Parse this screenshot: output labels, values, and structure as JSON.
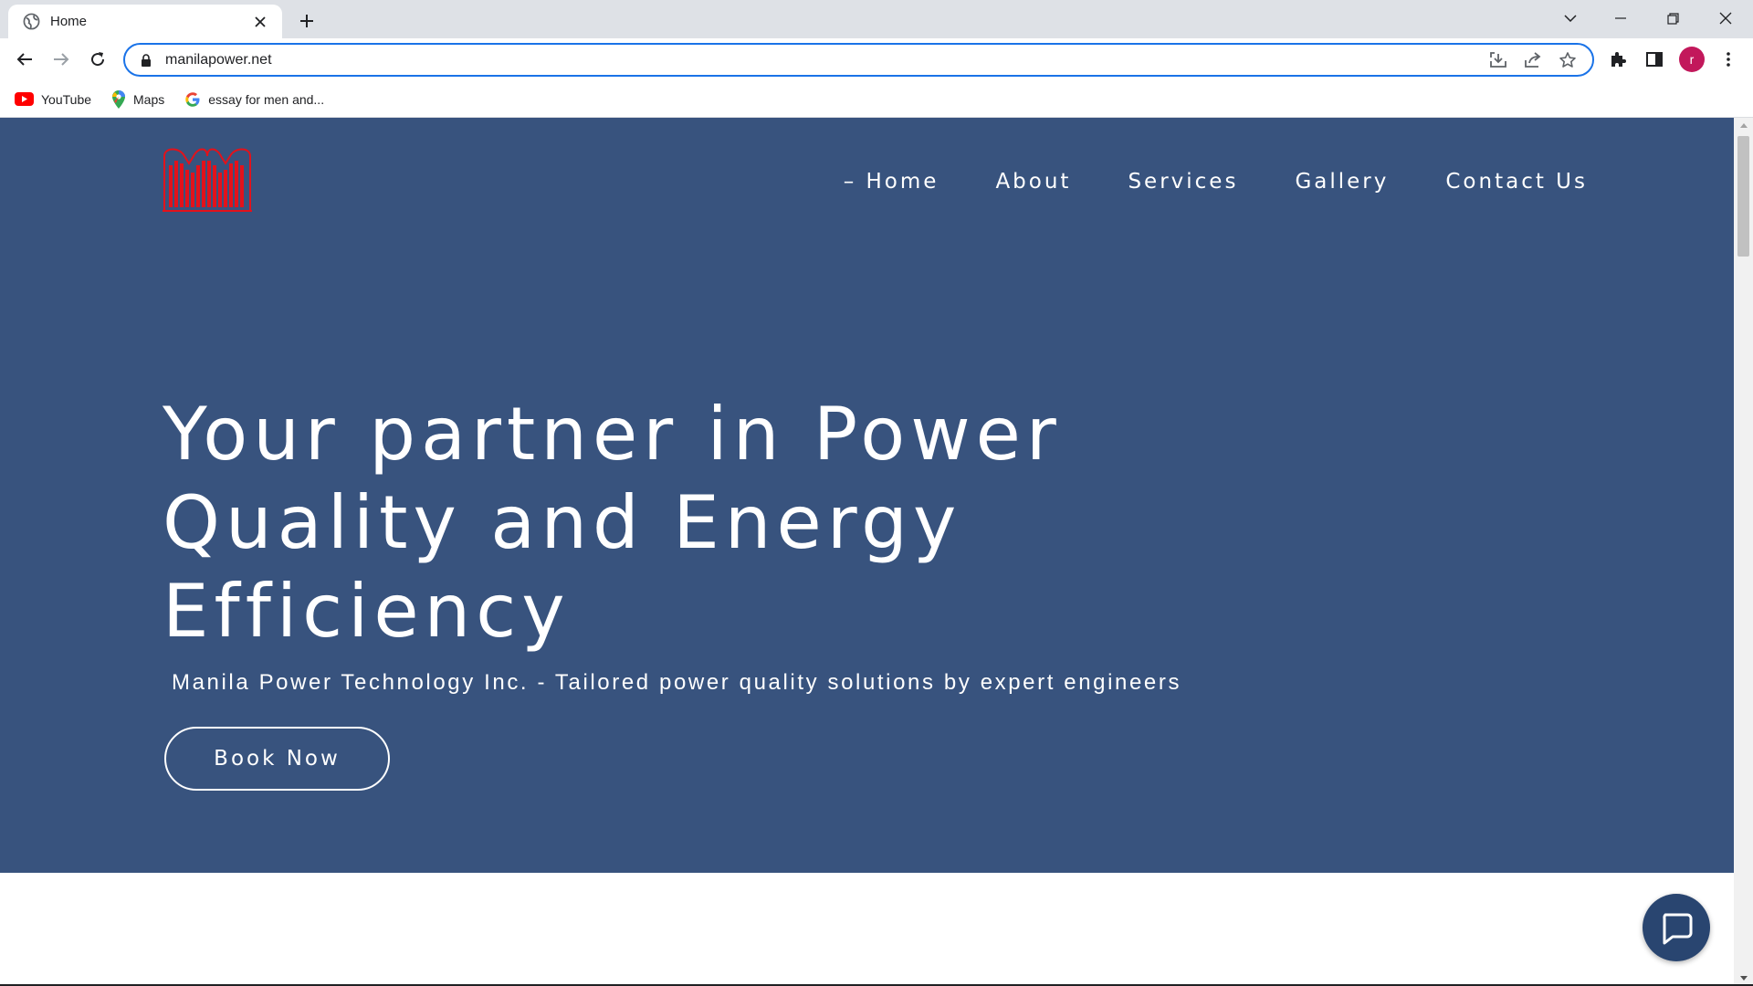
{
  "browser": {
    "tab_title": "Home",
    "url": "manilapower.net",
    "profile_initial": "r",
    "bookmarks": [
      {
        "label": "YouTube",
        "icon": "youtube-icon"
      },
      {
        "label": "Maps",
        "icon": "maps-icon"
      },
      {
        "label": "essay for men and...",
        "icon": "google-icon"
      }
    ]
  },
  "site": {
    "nav": [
      {
        "label": "– Home"
      },
      {
        "label": "About"
      },
      {
        "label": "Services"
      },
      {
        "label": "Gallery"
      },
      {
        "label": "Contact Us"
      }
    ],
    "headline_lines": [
      "Your partner in Power",
      "Quality and Energy",
      "Efficiency"
    ],
    "tagline": "Manila Power Technology Inc. - Tailored power quality solutions by expert engineers",
    "cta_label": "Book Now"
  },
  "colors": {
    "hero_bg": "#38537e",
    "logo_red": "#e3121b",
    "accent_blue": "#1a73e8",
    "chat_bg": "#294570"
  }
}
